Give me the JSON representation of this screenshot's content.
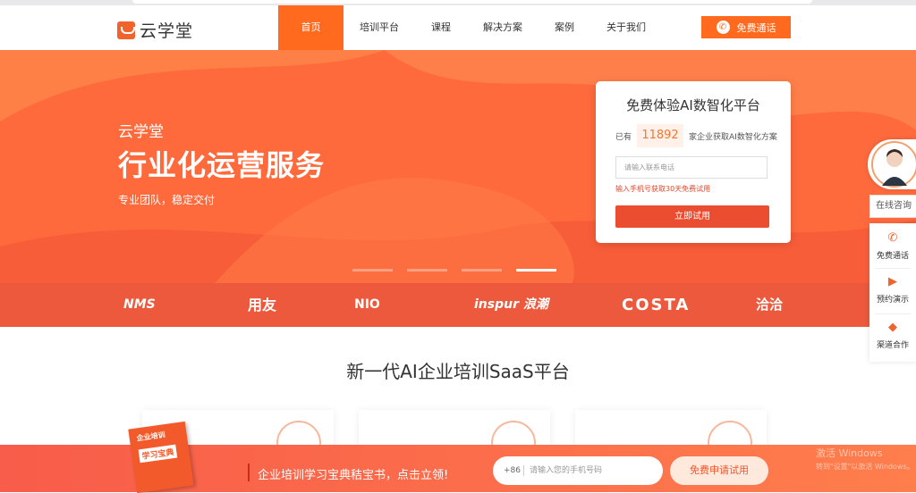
{
  "header": {
    "logo_text": "云学堂",
    "nav": [
      "首页",
      "培训平台",
      "课程",
      "解决方案",
      "案例",
      "关于我们"
    ],
    "call_button": "免费通话"
  },
  "hero": {
    "subtitle": "云学堂",
    "title": "行业化运营服务",
    "desc": "专业团队，稳定交付"
  },
  "form": {
    "title": "免费体验AI数智化平台",
    "count_prefix": "已有",
    "count": "11892",
    "count_suffix": "家企业获取AI数智化方案",
    "phone_placeholder": "请输入联系电话",
    "hint": "输入手机号获取30天免费试用",
    "submit": "立即试用"
  },
  "partners": [
    "NMS",
    "用友",
    "NIO",
    "inspur 浪潮",
    "COSTA",
    "洽洽"
  ],
  "section": {
    "title": "新一代AI企业培训SaaS平台"
  },
  "float": {
    "online": "在线咨询",
    "items": [
      "免费通话",
      "预约演示",
      "渠道合作"
    ]
  },
  "bottom": {
    "book_title": "企业培训",
    "book_sub": "学习宝典",
    "text": "企业培训学习宝典秸宝书，点击立领!",
    "country_code": "+86",
    "phone_placeholder": "请输入您的手机号码",
    "button": "免费申请试用"
  },
  "watermark": {
    "line1": "激活 Windows",
    "line2": "转到\"设置\"以激活 Windows。"
  },
  "colors": {
    "accent": "#ff6a1f",
    "hero": "#ff6a3d",
    "button": "#ea4d2f"
  }
}
